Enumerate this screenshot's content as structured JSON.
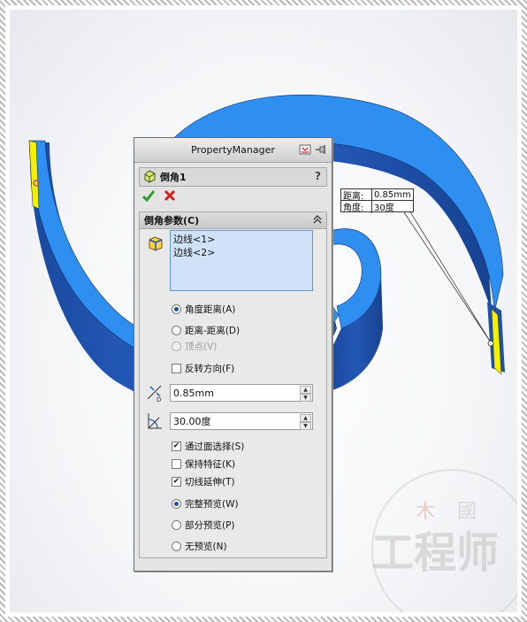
{
  "property_manager": {
    "title": "PropertyManager",
    "feature_name": "倒角1",
    "help": "?",
    "ok_icon": "checkmark-icon",
    "cancel_icon": "x-cross-icon",
    "group": {
      "title": "倒角参数(C)",
      "selections": [
        "边线<1>",
        "边线<2>"
      ],
      "type_options": [
        {
          "label": "角度距离(A)",
          "selected": true,
          "enabled": true
        },
        {
          "label": "距离-距离(D)",
          "selected": false,
          "enabled": true
        },
        {
          "label": "顶点(V)",
          "selected": false,
          "enabled": false
        }
      ],
      "flip_direction": {
        "label": "反转方向(F)",
        "checked": false
      },
      "distance": "0.85mm",
      "angle": "30.00度",
      "checkboxes": [
        {
          "label": "通过面选择(S)",
          "checked": true
        },
        {
          "label": "保持特征(K)",
          "checked": false
        },
        {
          "label": "切线延伸(T)",
          "checked": true
        }
      ],
      "preview_options": [
        {
          "label": "完整预览(W)",
          "selected": true
        },
        {
          "label": "部分预览(P)",
          "selected": false
        },
        {
          "label": "无预览(N)",
          "selected": false
        }
      ]
    }
  },
  "callout": {
    "distance_label": "距离:",
    "distance_value": "0.85mm",
    "angle_label": "角度:",
    "angle_value": "30度"
  },
  "watermark": {
    "line1_left": "木",
    "line1_right": "國",
    "line2": "工程师"
  },
  "colors": {
    "model_top": "#2f8ff0",
    "model_side": "#1b4ea6",
    "highlight_edge": "#f3f000",
    "selection_box": "#cfe2f7"
  }
}
